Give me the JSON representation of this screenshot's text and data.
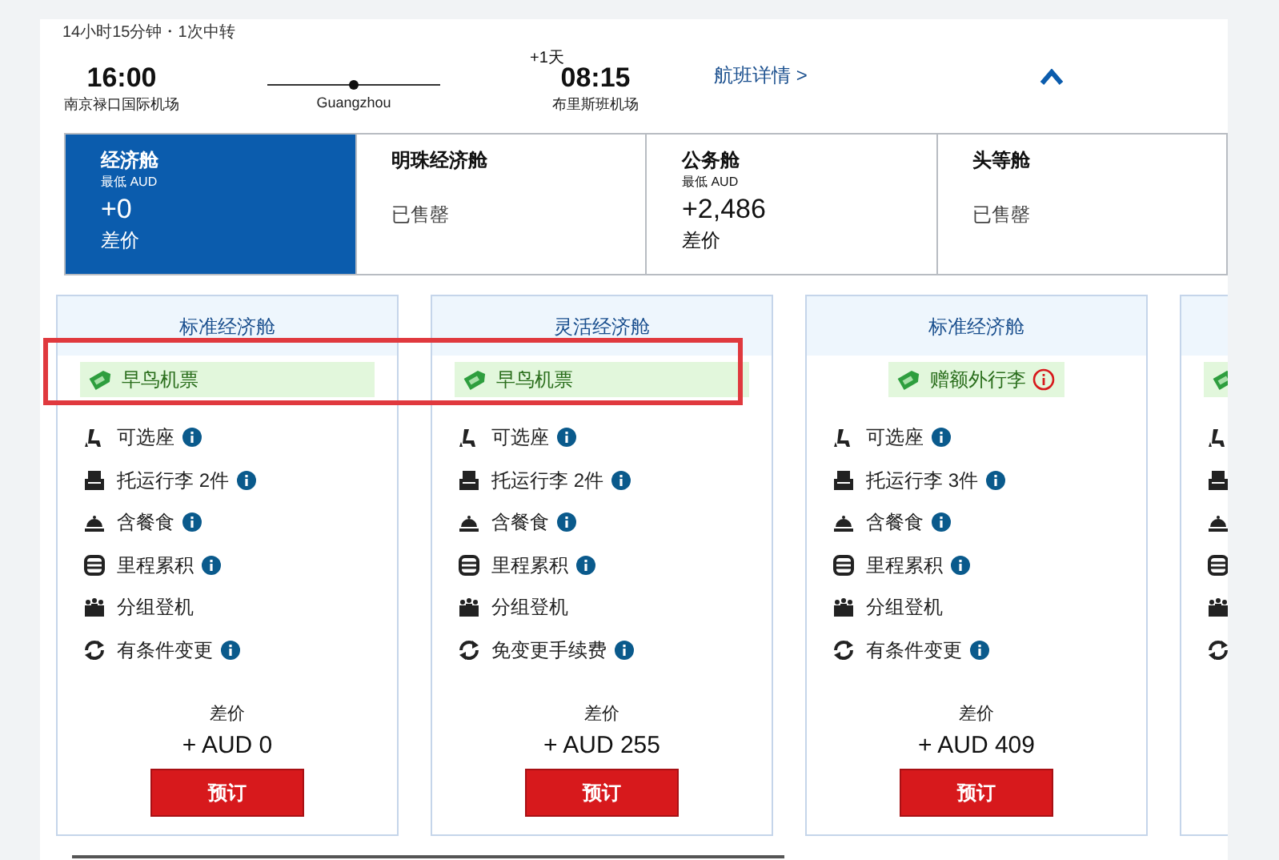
{
  "flight": {
    "summary": "14小时15分钟・1次中转",
    "depart": {
      "time": "16:00",
      "airport": "南京禄口国际机场"
    },
    "stop": "Guangzhou",
    "arrive": {
      "day_offset": "+1天",
      "time": "08:15",
      "airport": "布里斯班机场"
    },
    "details_link": "航班详情 >",
    "expanded": true
  },
  "cabins": [
    {
      "name": "经济舱",
      "selected": true,
      "from_label": "最低 AUD",
      "price": "+0",
      "note": "差价"
    },
    {
      "name": "明珠经济舱",
      "selected": false,
      "sold_out": "已售罄"
    },
    {
      "name": "公务舱",
      "selected": false,
      "from_label": "最低 AUD",
      "price": "+2,486",
      "note": "差价"
    },
    {
      "name": "头等舱",
      "selected": false,
      "sold_out": "已售罄"
    }
  ],
  "fares": [
    {
      "title": "标准经济舱",
      "badge": {
        "text": "早鸟机票",
        "info": false,
        "wide": true
      },
      "features": [
        {
          "kind": "seat",
          "label": "可选座",
          "info": true
        },
        {
          "kind": "bag",
          "label": "托运行李 2件",
          "info": true
        },
        {
          "kind": "meal",
          "label": "含餐食",
          "info": true
        },
        {
          "kind": "miles",
          "label": "里程累积",
          "info": true
        },
        {
          "kind": "boarding",
          "label": "分组登机",
          "info": false
        },
        {
          "kind": "change",
          "label": "有条件变更",
          "info": true
        }
      ],
      "price_label": "差价",
      "price": "+ AUD 0",
      "button": "预订"
    },
    {
      "title": "灵活经济舱",
      "badge": {
        "text": "早鸟机票",
        "info": false,
        "wide": true
      },
      "features": [
        {
          "kind": "seat",
          "label": "可选座",
          "info": true
        },
        {
          "kind": "bag",
          "label": "托运行李 2件",
          "info": true
        },
        {
          "kind": "meal",
          "label": "含餐食",
          "info": true
        },
        {
          "kind": "miles",
          "label": "里程累积",
          "info": true
        },
        {
          "kind": "boarding",
          "label": "分组登机",
          "info": false
        },
        {
          "kind": "change",
          "label": "免变更手续费",
          "info": true
        }
      ],
      "price_label": "差价",
      "price": "+ AUD 255",
      "button": "预订"
    },
    {
      "title": "标准经济舱",
      "badge": {
        "text": "赠额外行李",
        "info": true,
        "wide": false
      },
      "features": [
        {
          "kind": "seat",
          "label": "可选座",
          "info": true
        },
        {
          "kind": "bag",
          "label": "托运行李 3件",
          "info": true
        },
        {
          "kind": "meal",
          "label": "含餐食",
          "info": true
        },
        {
          "kind": "miles",
          "label": "里程累积",
          "info": true
        },
        {
          "kind": "boarding",
          "label": "分组登机",
          "info": false
        },
        {
          "kind": "change",
          "label": "有条件变更",
          "info": true
        }
      ],
      "price_label": "差价",
      "price": "+ AUD 409",
      "button": "预订"
    },
    {
      "badge": {
        "wide": true
      },
      "features": [
        {
          "kind": "seat"
        },
        {
          "kind": "bag"
        },
        {
          "kind": "meal"
        },
        {
          "kind": "miles"
        },
        {
          "kind": "boarding"
        },
        {
          "kind": "change"
        }
      ]
    }
  ]
}
